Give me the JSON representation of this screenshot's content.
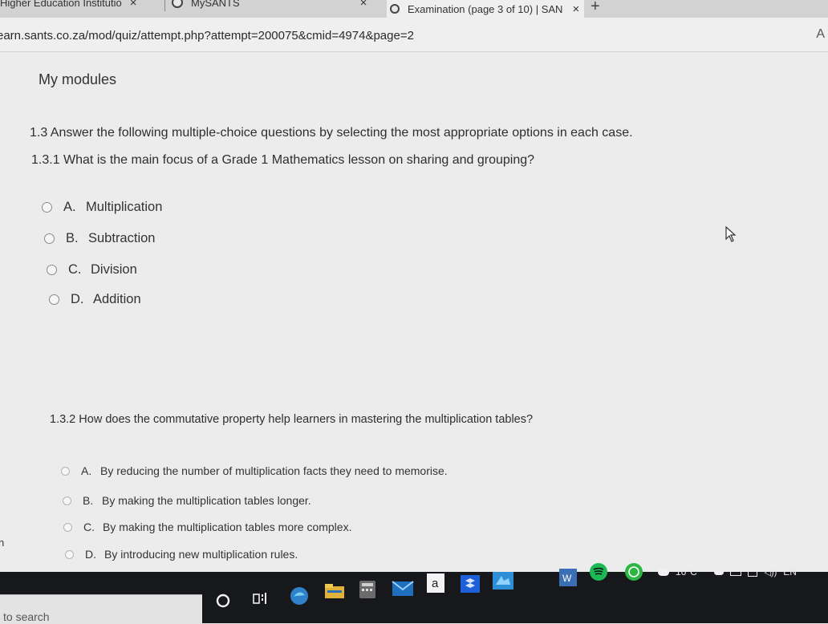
{
  "browser": {
    "tabs": [
      {
        "label": "Higher Education Institutio"
      },
      {
        "label": "MySANTS"
      },
      {
        "label": "Examination (page 3 of 10) | SAN"
      }
    ],
    "close_symbol": "×",
    "new_tab_symbol": "+",
    "url": "earn.sants.co.za/mod/quiz/attempt.php?attempt=200075&cmid=4974&page=2",
    "reader_mode_symbol": "A"
  },
  "page": {
    "nav_title": "My modules",
    "section_intro": "1.3 Answer the following multiple-choice questions by selecting the most appropriate options in each case.",
    "questions": [
      {
        "text": "1.3.1 What is the main focus of a Grade 1 Mathematics lesson on sharing and grouping?",
        "options": [
          {
            "letter": "A.",
            "text": "Multiplication",
            "selected": false
          },
          {
            "letter": "B.",
            "text": "Subtraction",
            "selected": false
          },
          {
            "letter": "C.",
            "text": "Division",
            "selected": false
          },
          {
            "letter": "D.",
            "text": "Addition",
            "selected": false
          }
        ]
      },
      {
        "text": "1.3.2 How does the commutative property help learners in mastering the multiplication tables?",
        "options": [
          {
            "letter": "A.",
            "text": "By reducing the number of multiplication facts they need to memorise.",
            "selected": false
          },
          {
            "letter": "B.",
            "text": "By making the multiplication tables longer.",
            "selected": false
          },
          {
            "letter": "C.",
            "text": "By making the multiplication tables more complex.",
            "selected": false
          },
          {
            "letter": "D.",
            "text": "By introducing new multiplication rules.",
            "selected": false
          }
        ]
      }
    ],
    "edge_fragment": "n"
  },
  "taskbar": {
    "search_placeholder": "to search",
    "apps": [
      "cortana-icon",
      "task-view-icon",
      "edge-icon",
      "file-explorer-icon",
      "calculator-icon",
      "mail-icon",
      "amazon-icon",
      "dropbox-icon",
      "azure-icon",
      "word-icon",
      "spotify-icon",
      "whatsapp-icon"
    ],
    "weather": "16°C",
    "language": "EN"
  }
}
